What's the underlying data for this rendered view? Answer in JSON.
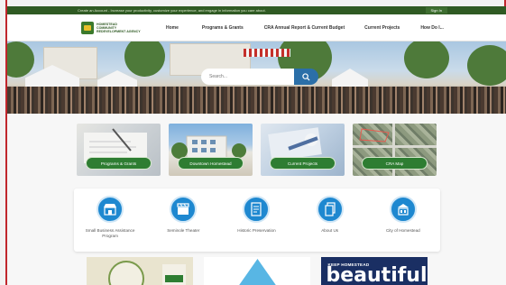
{
  "topbar": {
    "message": "Create an Account - Increase your productivity, customize your experience, and engage in information you care about.",
    "signin_label": "Sign In"
  },
  "logo": {
    "line1": "HOMESTEAD",
    "line2": "COMMUNITY",
    "line3": "REDEVELOPMENT AGENCY"
  },
  "nav": {
    "items": [
      {
        "label": "Home"
      },
      {
        "label": "Programs & Grants"
      },
      {
        "label": "CRA Annual Report & Current Budget"
      },
      {
        "label": "Current Projects"
      },
      {
        "label": "How Do I..."
      }
    ]
  },
  "search": {
    "placeholder": "Search..."
  },
  "quick_links": [
    {
      "label": "Programs & Grants"
    },
    {
      "label": "Downtown Homestead"
    },
    {
      "label": "Current Projects"
    },
    {
      "label": "CRA Map"
    }
  ],
  "services": [
    {
      "label": "Small Business Assistance Program",
      "icon": "storefront-icon"
    },
    {
      "label": "Seminole Theater",
      "icon": "clapperboard-icon"
    },
    {
      "label": "Historic Preservation",
      "icon": "document-icon"
    },
    {
      "label": "About Us",
      "icon": "pages-icon"
    },
    {
      "label": "City of Homestead",
      "icon": "building-icon"
    }
  ],
  "promos": {
    "banner_kicker": "KEEP HOMESTEAD",
    "banner_word": "beautiful"
  },
  "colors": {
    "topbar": "#2f5a23",
    "pill": "#2e7d32",
    "icon_circle": "#1e88d0",
    "search_button": "#2b6fa8"
  }
}
